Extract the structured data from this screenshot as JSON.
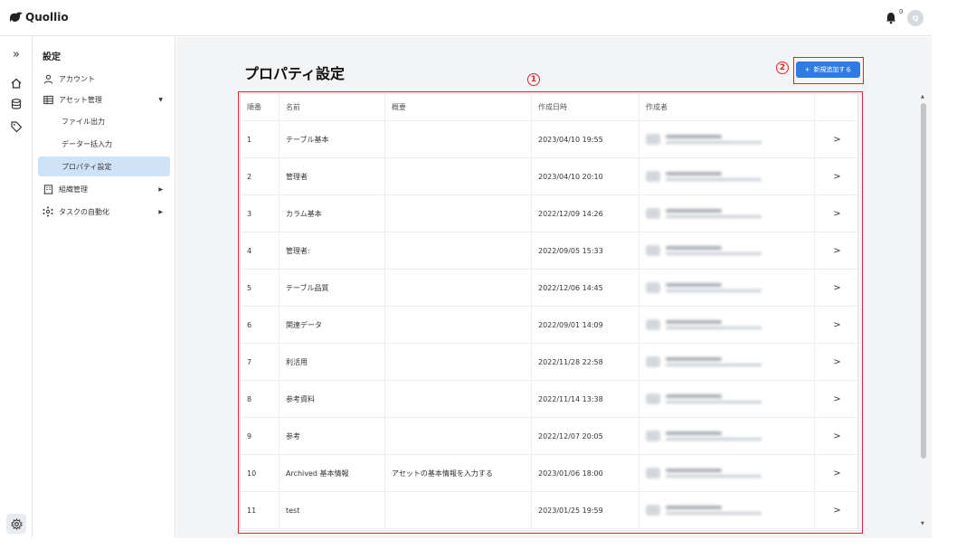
{
  "app": {
    "name": "Quollio",
    "notification_count": "0",
    "avatar_initial": "Q"
  },
  "sidebar": {
    "title": "設定",
    "items": [
      {
        "label": "アカウント",
        "icon": "user-icon",
        "active": false
      },
      {
        "label": "アセット管理",
        "icon": "table-icon",
        "expanded": true
      },
      {
        "label": "ファイル出力",
        "sub": true
      },
      {
        "label": "データー括入力",
        "sub": true
      },
      {
        "label": "プロパティ設定",
        "sub": true,
        "active": true
      },
      {
        "label": "組織管理",
        "icon": "building-icon",
        "expanded": false
      },
      {
        "label": "タスクの自動化",
        "icon": "automation-icon",
        "expanded": false
      }
    ]
  },
  "page": {
    "title": "プロパティ設定",
    "add_button_label": "新規追加する",
    "callout_table": "1",
    "callout_button": "2"
  },
  "table": {
    "headers": [
      "順番",
      "名前",
      "概要",
      "作成日時",
      "作成者"
    ],
    "rows": [
      {
        "order": "1",
        "name": "テーブル基本",
        "summary": "",
        "created": "2023/04/10 19:55"
      },
      {
        "order": "2",
        "name": "管理者",
        "summary": "",
        "created": "2023/04/10 20:10"
      },
      {
        "order": "3",
        "name": "カラム基本",
        "summary": "",
        "created": "2022/12/09 14:26"
      },
      {
        "order": "4",
        "name": "管理者:",
        "summary": "",
        "created": "2022/09/05 15:33"
      },
      {
        "order": "5",
        "name": "テーブル品質",
        "summary": "",
        "created": "2022/12/06 14:45"
      },
      {
        "order": "6",
        "name": "関連データ",
        "summary": "",
        "created": "2022/09/01 14:09"
      },
      {
        "order": "7",
        "name": "利活用",
        "summary": "",
        "created": "2022/11/28 22:58"
      },
      {
        "order": "8",
        "name": "参考資料",
        "summary": "",
        "created": "2022/11/14 13:38"
      },
      {
        "order": "9",
        "name": "参考",
        "summary": "",
        "created": "2022/12/07 20:05"
      },
      {
        "order": "10",
        "name": "Archived 基本情報",
        "summary": "アセットの基本情報を入力する",
        "created": "2023/01/06 18:00"
      },
      {
        "order": "11",
        "name": "test",
        "summary": "",
        "created": "2023/01/25 19:59"
      }
    ]
  },
  "colors": {
    "accent": "#2f7be0",
    "annotation": "#e0262b",
    "active_nav": "#cfe3f8"
  }
}
